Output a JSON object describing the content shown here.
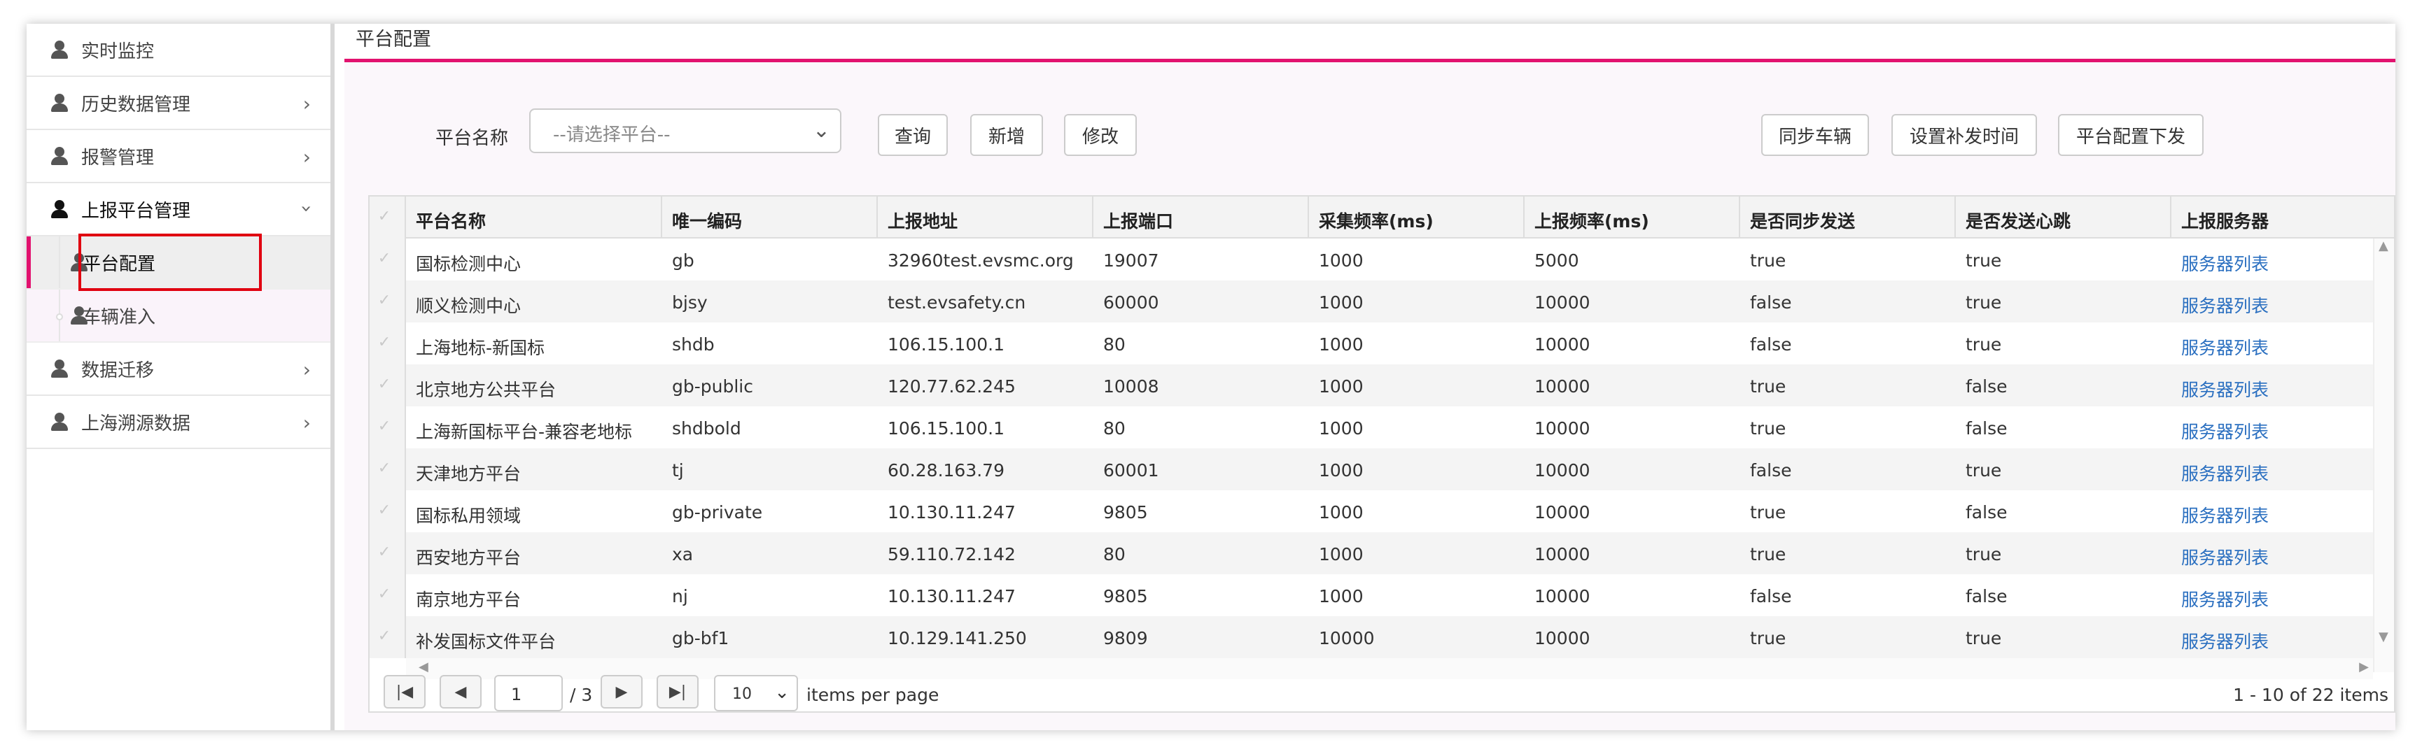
{
  "sidebar": {
    "items": [
      {
        "label": "实时监控"
      },
      {
        "label": "历史数据管理"
      },
      {
        "label": "报警管理"
      },
      {
        "label": "上报平台管理"
      },
      {
        "label": "数据迁移"
      },
      {
        "label": "上海溯源数据"
      }
    ],
    "sub_items": [
      {
        "label": "平台配置"
      },
      {
        "label": "车辆准入"
      }
    ]
  },
  "page": {
    "title": "平台配置",
    "filter_label": "平台名称",
    "select_placeholder": "--请选择平台--"
  },
  "toolbar": {
    "query_label": "查询",
    "add_label": "新增",
    "edit_label": "修改",
    "sync_vehicle_label": "同步车辆",
    "set_resend_time_label": "设置补发时间",
    "dispatch_label": "平台配置下发"
  },
  "table": {
    "columns": [
      "平台名称",
      "唯一编码",
      "上报地址",
      "上报端口",
      "采集频率(ms)",
      "上报频率(ms)",
      "是否同步发送",
      "是否发送心跳",
      "上报服务器"
    ],
    "rows": [
      [
        "国标检测中心",
        "gb",
        "32960test.evsmc.org",
        "19007",
        "1000",
        "5000",
        "true",
        "true",
        "服务器列表"
      ],
      [
        "顺义检测中心",
        "bjsy",
        "test.evsafety.cn",
        "60000",
        "1000",
        "10000",
        "false",
        "true",
        "服务器列表"
      ],
      [
        "上海地标-新国标",
        "shdb",
        "106.15.100.1",
        "80",
        "1000",
        "10000",
        "false",
        "true",
        "服务器列表"
      ],
      [
        "北京地方公共平台",
        "gb-public",
        "120.77.62.245",
        "10008",
        "1000",
        "10000",
        "true",
        "false",
        "服务器列表"
      ],
      [
        "上海新国标平台-兼容老地标",
        "shdbold",
        "106.15.100.1",
        "80",
        "1000",
        "10000",
        "true",
        "false",
        "服务器列表"
      ],
      [
        "天津地方平台",
        "tj",
        "60.28.163.79",
        "60001",
        "1000",
        "10000",
        "false",
        "true",
        "服务器列表"
      ],
      [
        "国标私用领域",
        "gb-private",
        "10.130.11.247",
        "9805",
        "1000",
        "10000",
        "true",
        "false",
        "服务器列表"
      ],
      [
        "西安地方平台",
        "xa",
        "59.110.72.142",
        "80",
        "1000",
        "10000",
        "true",
        "true",
        "服务器列表"
      ],
      [
        "南京地方平台",
        "nj",
        "10.130.11.247",
        "9805",
        "1000",
        "10000",
        "false",
        "false",
        "服务器列表"
      ],
      [
        "补发国标文件平台",
        "gb-bf1",
        "10.129.141.250",
        "9809",
        "10000",
        "10000",
        "true",
        "true",
        "服务器列表"
      ]
    ]
  },
  "pager": {
    "page_value": "1",
    "page_total": "/ 3",
    "page_size": "10",
    "items_per_page": "items per page",
    "summary": "1 - 10 of 22 items"
  },
  "colors": {
    "accent": "#e2126f",
    "highlight_box": "#e00010",
    "link": "#2a6fc0"
  }
}
